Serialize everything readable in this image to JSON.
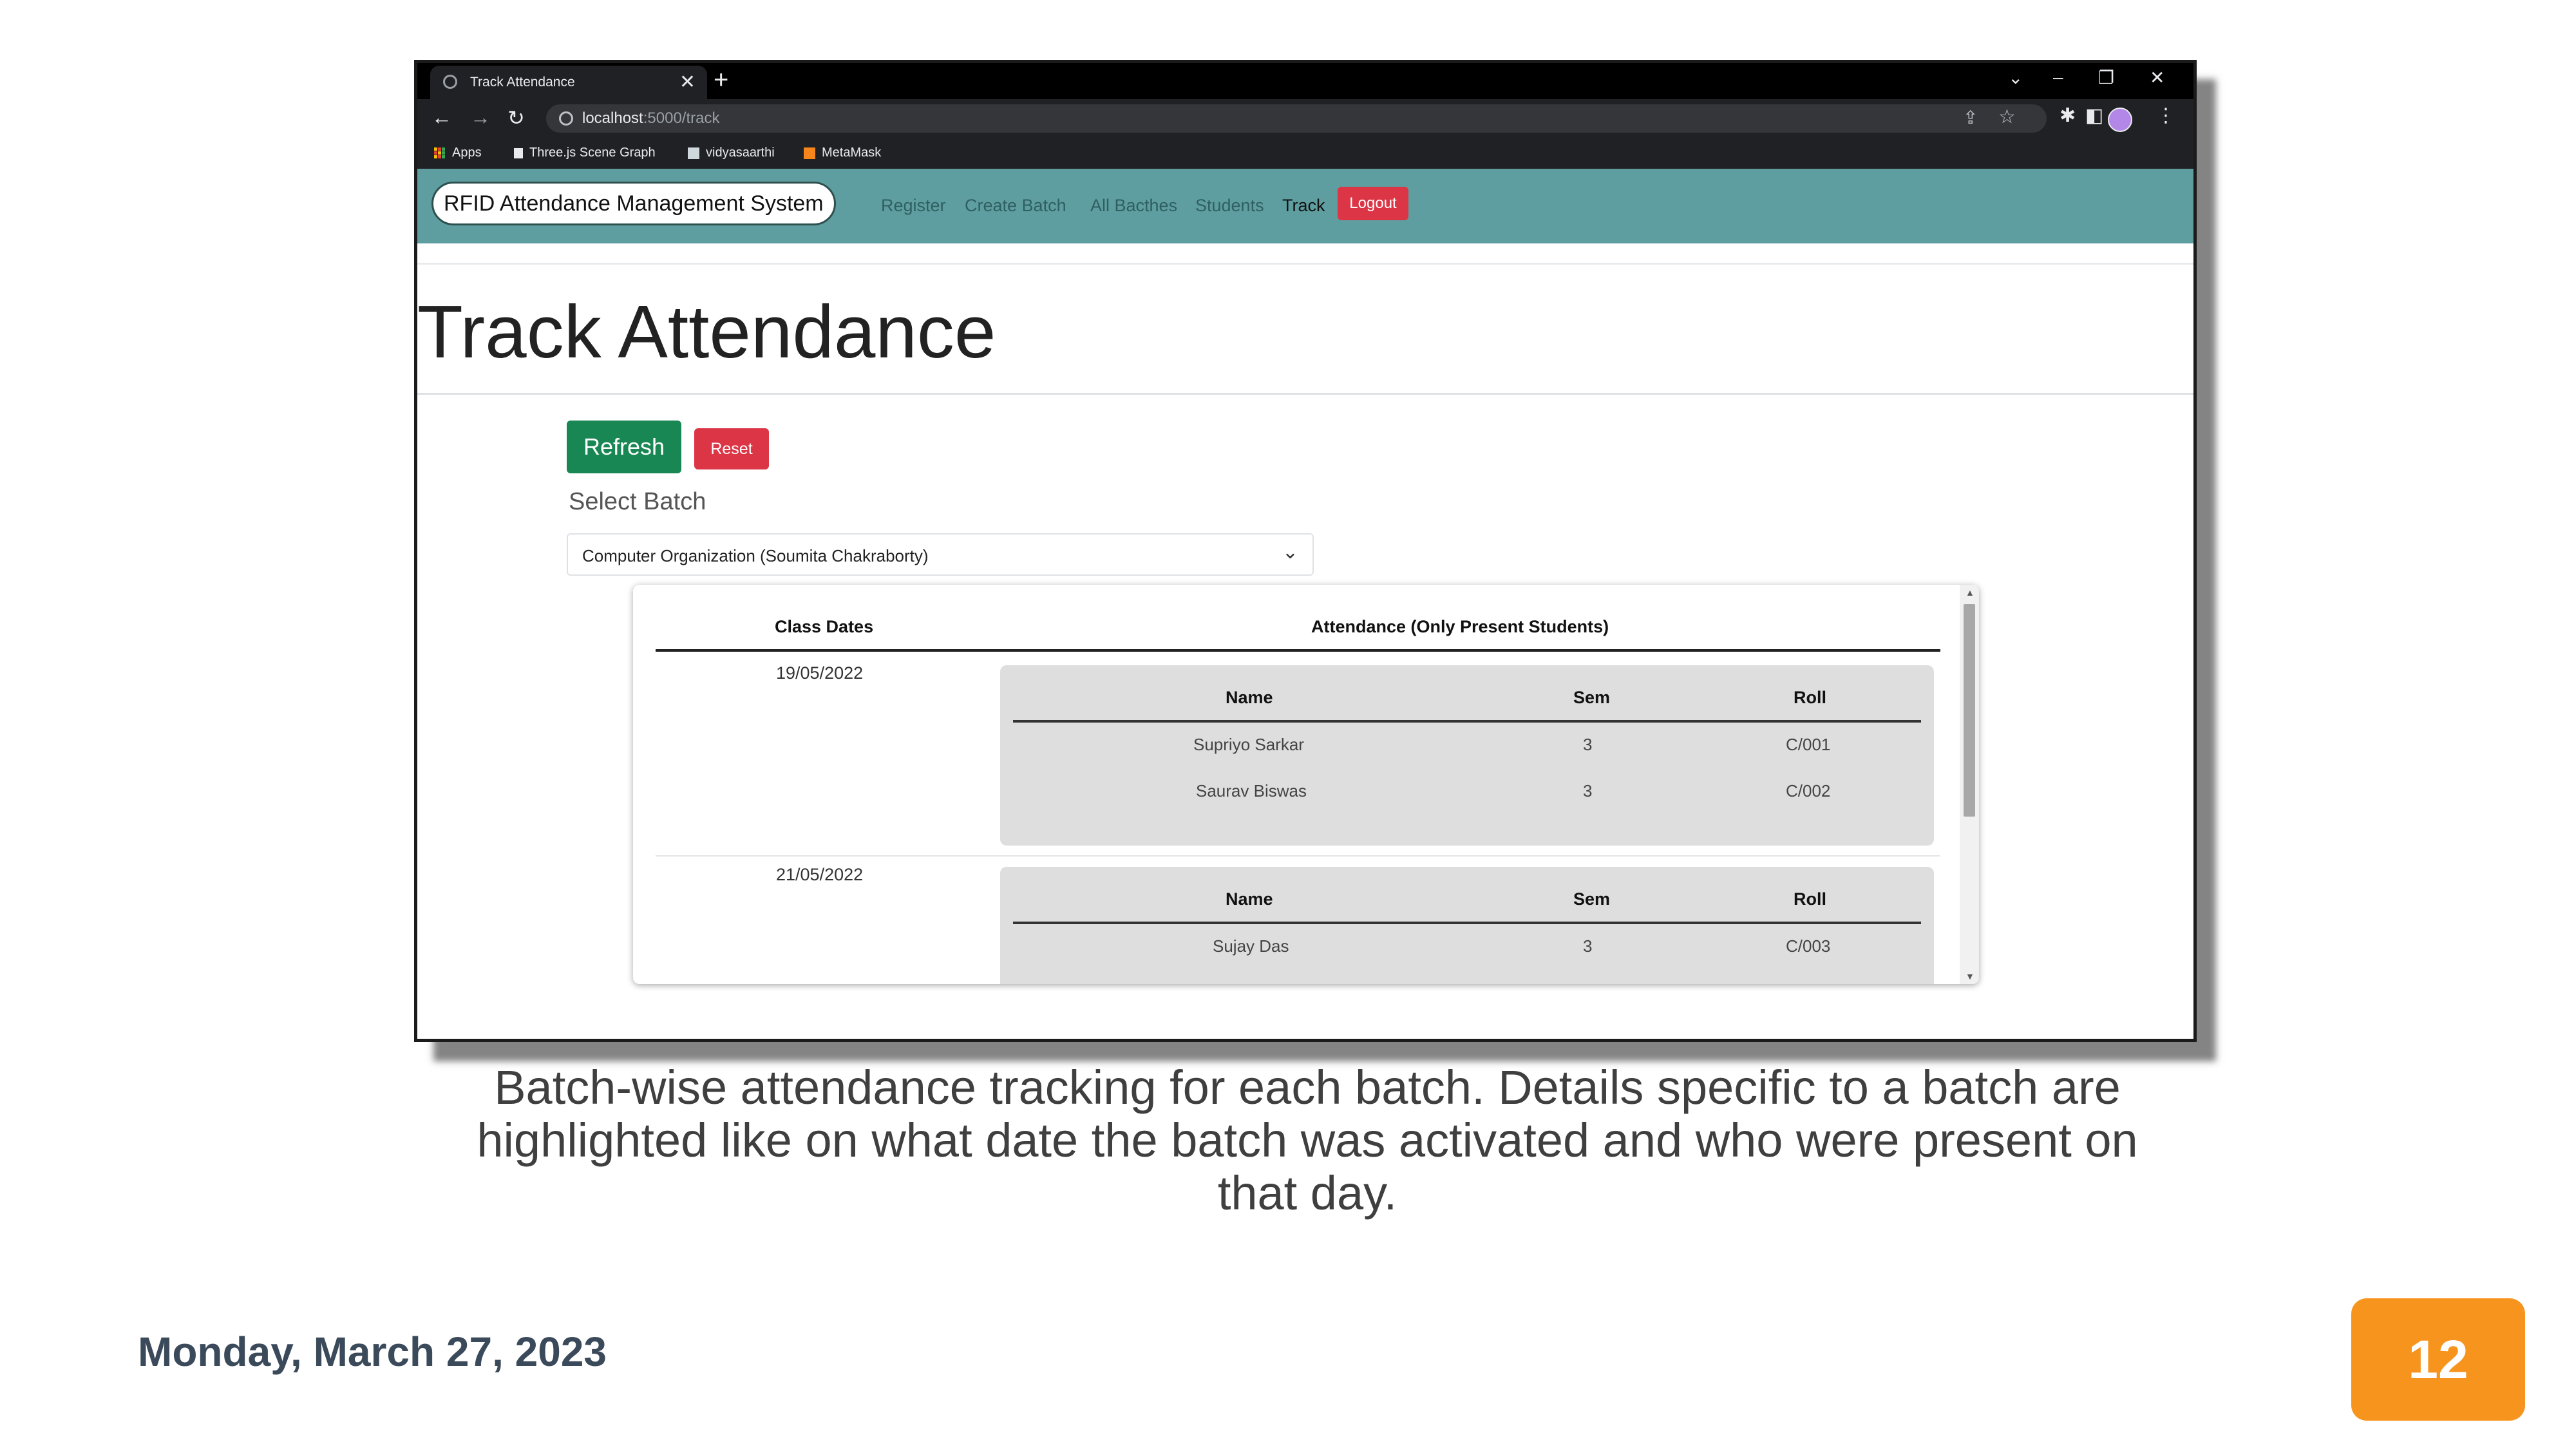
{
  "browser": {
    "tab_title": "Track Attendance",
    "tab_close": "✕",
    "new_tab": "+",
    "window_controls": [
      "⌄",
      "–",
      "❐",
      "✕"
    ],
    "url_host": "localhost",
    "url_path": ":5000/track",
    "bookmarks": [
      {
        "label": "Apps",
        "icon": "apps-grid-icon"
      },
      {
        "label": "Three.js Scene Graph",
        "icon": "page-icon"
      },
      {
        "label": "vidyasaarthi",
        "icon": "image-icon"
      },
      {
        "label": "MetaMask",
        "icon": "fox-icon"
      }
    ]
  },
  "app": {
    "brand": "RFID Attendance Management System",
    "nav": [
      "Register",
      "Create Batch",
      "All Bacthes",
      "Students",
      "Track"
    ],
    "active_nav": "Track",
    "logout": "Logout",
    "nav_color": "#5f9ea0"
  },
  "page": {
    "title": "Track Attendance",
    "refresh_label": "Refresh",
    "reset_label": "Reset",
    "select_label": "Select Batch",
    "selected_batch": "Computer Organization (Soumita Chakraborty)"
  },
  "attendance": {
    "col_dates": "Class Dates",
    "col_attendance": "Attendance (Only Present Students)",
    "inner_headers": [
      "Name",
      "Sem",
      "Roll"
    ],
    "records": [
      {
        "date": "19/05/2022",
        "students": [
          {
            "name": "Supriyo Sarkar",
            "sem": "3",
            "roll": "C/001"
          },
          {
            "name": "Saurav Biswas",
            "sem": "3",
            "roll": "C/002"
          }
        ]
      },
      {
        "date": "21/05/2022",
        "students": [
          {
            "name": "Sujay Das",
            "sem": "3",
            "roll": "C/003"
          }
        ]
      }
    ]
  },
  "slide": {
    "caption": "Batch-wise attendance tracking for each batch. Details specific to a batch are highlighted like on what date the batch was activated and who were present on that day.",
    "date": "Monday, March 27, 2023",
    "page_number": "12",
    "badge_color": "#f7941d"
  }
}
